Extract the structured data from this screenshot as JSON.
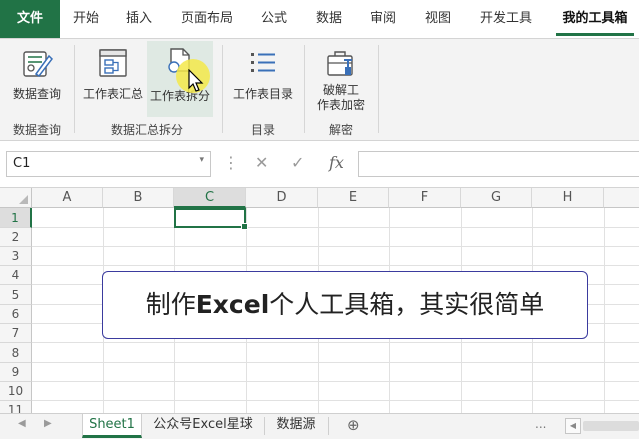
{
  "ribbon_tabs": [
    "文件",
    "开始",
    "插入",
    "页面布局",
    "公式",
    "数据",
    "审阅",
    "视图",
    "开发工具",
    "我的工具箱"
  ],
  "ribbon": {
    "buttons": {
      "data_query": "数据查询",
      "sheet_summary": "工作表汇总",
      "sheet_split": "工作表拆分",
      "sheet_directory": "工作表目录",
      "crack_line1": "破解工",
      "crack_line2": "作表加密"
    },
    "groups": {
      "data_query": "数据查询",
      "summary_split": "数据汇总拆分",
      "directory": "目录",
      "decrypt": "解密"
    }
  },
  "formula_bar": {
    "name_box": "C1",
    "name_dropdown": "▾",
    "dots": "⋮",
    "cancel": "✕",
    "enter": "✓",
    "fx": "fx",
    "formula": ""
  },
  "grid": {
    "columns": [
      "A",
      "B",
      "C",
      "D",
      "E",
      "F",
      "G",
      "H"
    ],
    "rows": [
      "1",
      "2",
      "3",
      "4",
      "5",
      "6",
      "7",
      "8",
      "9",
      "10",
      "11"
    ],
    "active_cell": "C1"
  },
  "caption": {
    "text_before": "制作",
    "text_bold": "Excel",
    "text_after": "个人工具箱，其实很简单"
  },
  "sheets": [
    "Sheet1",
    "公众号Excel星球",
    "数据源"
  ],
  "sheet_controls": {
    "prev": "◀",
    "next": "▶",
    "more": "...",
    "add": "⊕"
  },
  "colors": {
    "accent": "#217346",
    "cursor_highlight": "#f5e94a",
    "caption_border": "#3b3b9e"
  }
}
